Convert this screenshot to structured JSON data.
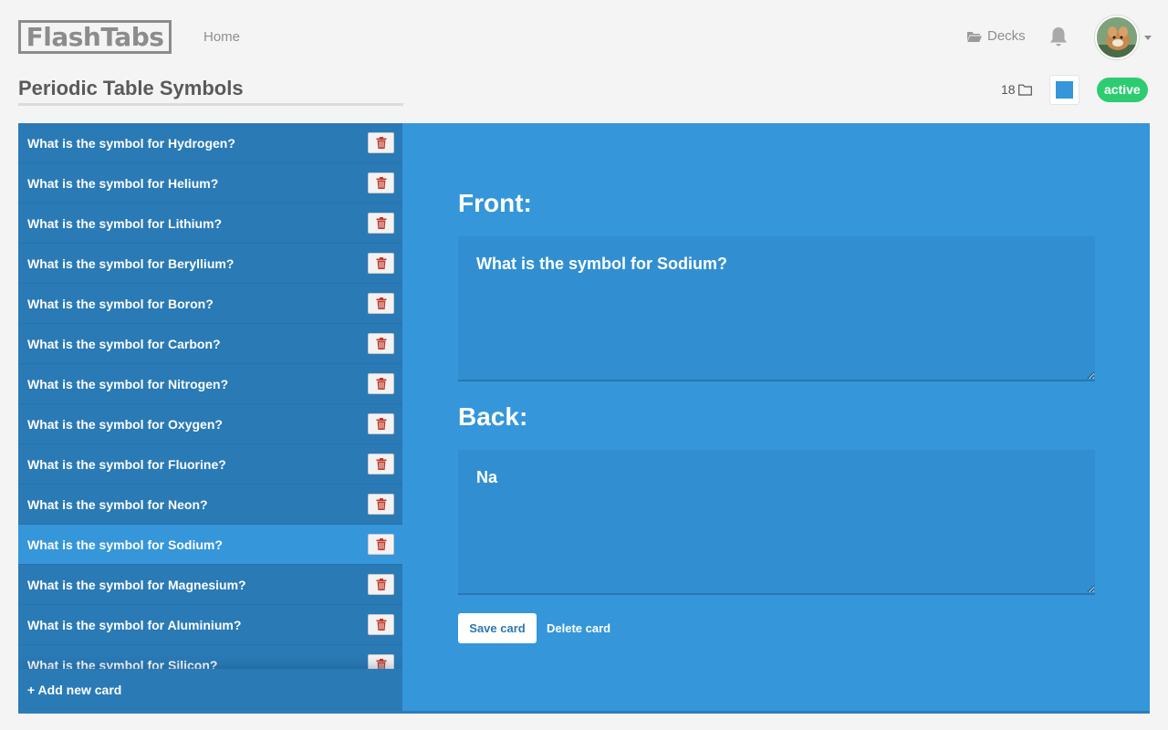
{
  "nav": {
    "logo_text": "FlashTabs",
    "home_label": "Home",
    "decks_label": "Decks",
    "bell_icon": "bell-icon",
    "decks_icon": "folder-open-icon",
    "avatar_caret_icon": "caret-down-icon"
  },
  "deck": {
    "title": "Periodic Table Symbols",
    "card_count": "18",
    "card_count_icon": "folder-icon",
    "color": "#3596da",
    "status": "active",
    "status_color": "#2ecc71"
  },
  "cards": [
    {
      "question": "What is the symbol for Hydrogen?"
    },
    {
      "question": "What is the symbol for Helium?"
    },
    {
      "question": "What is the symbol for Lithium?"
    },
    {
      "question": "What is the symbol for Beryllium?"
    },
    {
      "question": "What is the symbol for Boron?"
    },
    {
      "question": "What is the symbol for Carbon?"
    },
    {
      "question": "What is the symbol for Nitrogen?"
    },
    {
      "question": "What is the symbol for Oxygen?"
    },
    {
      "question": "What is the symbol for Fluorine?"
    },
    {
      "question": "What is the symbol for Neon?"
    },
    {
      "question": "What is the symbol for Sodium?"
    },
    {
      "question": "What is the symbol for Magnesium?"
    },
    {
      "question": "What is the symbol for Aluminium?"
    },
    {
      "question": "What is the symbol for Silicon?"
    }
  ],
  "selected_card_index": 10,
  "card_delete_icon": "trash-icon",
  "add_card_label": "+ Add new card",
  "editor": {
    "front_heading": "Front:",
    "front_value": "What is the symbol for Sodium?",
    "back_heading": "Back:",
    "back_value": "Na",
    "save_label": "Save card",
    "delete_label": "Delete card"
  },
  "colors": {
    "primary": "#3596da",
    "sidebar": "#2a7ab6",
    "trash_red": "#c0392b"
  }
}
